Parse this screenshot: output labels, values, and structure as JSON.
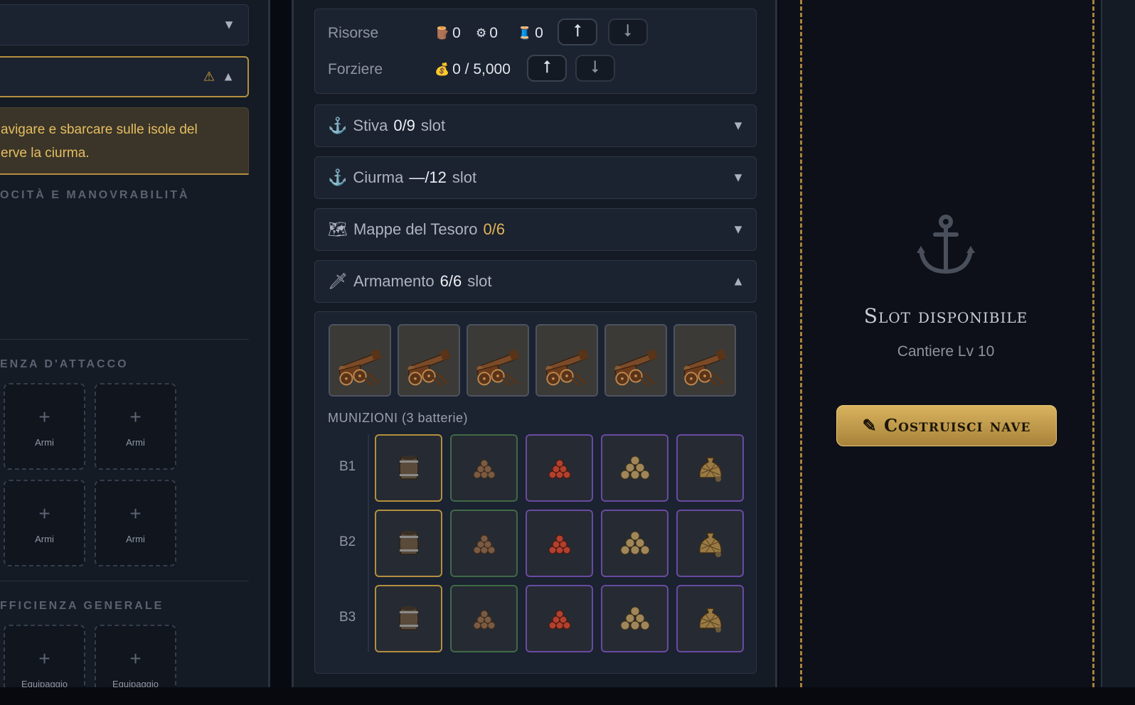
{
  "left_panel": {
    "warning_icon": "⚠",
    "info_text_line1": "avigare e sbarcare sulle isole del",
    "info_text_line2": "erve la ciurma.",
    "section_speed": "OCITÀ E MANOVRABILITÀ",
    "section_attack": "ENZA D'ATTACCO",
    "section_general": "FFICIENZA GENERALE",
    "slot_plus": "+",
    "slot_label_weapons": "Armi",
    "slot_label_equipment": "Equipaggio"
  },
  "resources": {
    "label": "Risorse",
    "wood_value": "0",
    "gear_value": "0",
    "thread_value": "0",
    "chest_label": "Forziere",
    "chest_value": "0 / 5,000",
    "up_arrow": "⭡",
    "down_arrow": "⭣"
  },
  "accordions": {
    "hold": {
      "label": "Stiva",
      "count": "0/9",
      "unit": "slot"
    },
    "crew": {
      "label": "Ciurma",
      "count": "—/12",
      "unit": "slot"
    },
    "maps": {
      "label": "Mappe del Tesoro",
      "count": "0/6"
    },
    "armament": {
      "label": "Armamento",
      "count": "6/6",
      "unit": "slot"
    }
  },
  "armament": {
    "cannon_count": 6,
    "ammo_heading": "MUNIZIONI (3 batterie)",
    "batteries": [
      "B1",
      "B2",
      "B3"
    ],
    "ammo_types": [
      "powder-barrel",
      "iron-balls",
      "red-balls",
      "bronze-balls",
      "grape-shot-sack"
    ],
    "ammo_rarity": [
      "gold",
      "green",
      "purple",
      "purple",
      "purple"
    ]
  },
  "right_panel": {
    "slot_title": "Slot disponibile",
    "slot_subtitle": "Cantiere Lv 10",
    "build_button": "✎ Costruisci nave"
  },
  "colors": {
    "accent_gold": "#b48f3f",
    "panel_bg": "#151b25",
    "card_bg": "#1b2230"
  }
}
